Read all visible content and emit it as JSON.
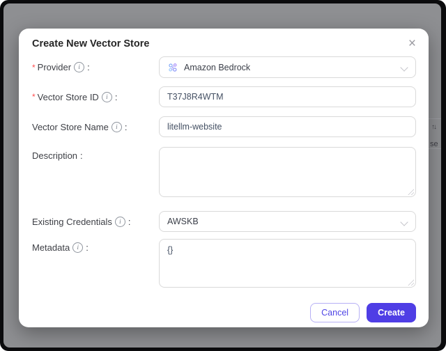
{
  "modal": {
    "title": "Create New Vector Store",
    "close_icon": "×",
    "required_mark": "*",
    "colon": ":"
  },
  "icons": {
    "info": "i"
  },
  "form": {
    "provider": {
      "label": "Provider",
      "required": true,
      "value": "Amazon Bedrock"
    },
    "vector_store_id": {
      "label": "Vector Store ID",
      "required": true,
      "value": "T37J8R4WTM"
    },
    "vector_store_name": {
      "label": "Vector Store Name",
      "required": false,
      "value": "litellm-website"
    },
    "description": {
      "label": "Description",
      "required": false,
      "value": ""
    },
    "existing_credentials": {
      "label": "Existing Credentials",
      "required": false,
      "value": "AWSKB"
    },
    "metadata": {
      "label": "Metadata",
      "required": false,
      "value": "{}"
    }
  },
  "footer": {
    "cancel_label": "Cancel",
    "create_label": "Create"
  },
  "background": {
    "sort_icon": "↑↓",
    "partial_text": "se"
  },
  "colors": {
    "accent": "#4f3ee5",
    "cancel_border": "#b7b0f5",
    "required": "#ff4d4f",
    "overlay_gray": "#8e8f92",
    "frame_black": "#0b0b0d"
  }
}
